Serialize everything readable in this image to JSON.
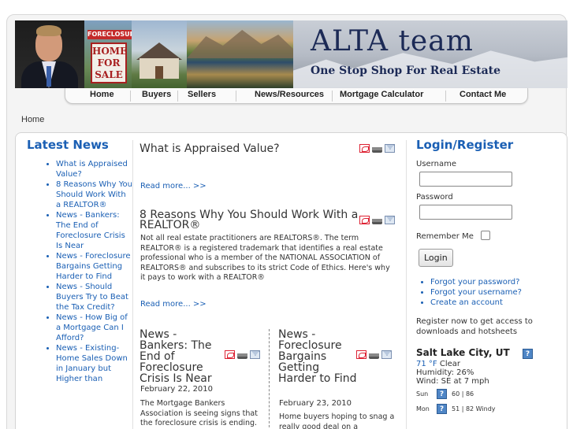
{
  "header": {
    "brand_title": "ALTA team",
    "brand_tagline": "One Stop Shop For Real Estate",
    "sign_top": "FORECLOSURE",
    "sign_main": "HOME FOR SALE"
  },
  "nav": {
    "items": [
      "Home",
      "Buyers",
      "Sellers",
      "News/Resources",
      "Mortgage Calculator",
      "Contact Me"
    ]
  },
  "breadcrumb": "Home",
  "latest_news": {
    "heading": "Latest News",
    "items": [
      "What is Appraised Value?",
      "8 Reasons Why You Should Work With a REALTOR®",
      "News - Bankers: The End of Foreclosure Crisis Is Near",
      "News - Foreclosure Bargains Getting Harder to Find",
      "News - Should Buyers Try to Beat the Tax Credit?",
      "News - How Big of a Mortgage Can I Afford?",
      "News - Existing-Home Sales Down in January but Higher than"
    ]
  },
  "articles": [
    {
      "title": "What is Appraised Value?",
      "read_more": "Read more... >>"
    },
    {
      "title_line1": "8 Reasons Why You Should Work With a",
      "title_line2": "REALTOR®",
      "body": "Not all real estate practitioners are REALTORS®. The term REALTOR® is a registered trademark that identifies a real estate professional who is a member of the NATIONAL ASSOCIATION of REALTORS® and subscribes to its strict Code of Ethics. Here's why it pays to work with a REALTOR®",
      "read_more": "Read more... >>"
    },
    {
      "title": "News - Bankers: The End of Foreclosure Crisis Is Near",
      "date": "February 22, 2010",
      "body": "The Mortgage Bankers Association is seeing signs that the foreclosure crisis is ending."
    },
    {
      "title": "News - Foreclosure Bargains Getting Harder to Find",
      "date": "February 23, 2010",
      "body": "Home buyers hoping to snag a really good deal on a"
    }
  ],
  "login": {
    "heading": "Login/Register",
    "username_label": "Username",
    "password_label": "Password",
    "remember_label": "Remember Me",
    "login_button": "Login",
    "links": [
      "Forgot your password?",
      "Forgot your username?",
      "Create an account"
    ],
    "register_note": "Register now to get access to downloads and hotsheets"
  },
  "weather": {
    "city": "Salt Lake City, UT",
    "temp": "71 °F",
    "condition": "Clear",
    "humidity": "Humidity: 26%",
    "wind": "Wind: SE at 7 mph",
    "icon_glyph": "?",
    "forecast": [
      {
        "day": "Sun",
        "temps": "60 | 86"
      },
      {
        "day": "Mon",
        "temps": "51 | 82 Windy"
      }
    ]
  }
}
